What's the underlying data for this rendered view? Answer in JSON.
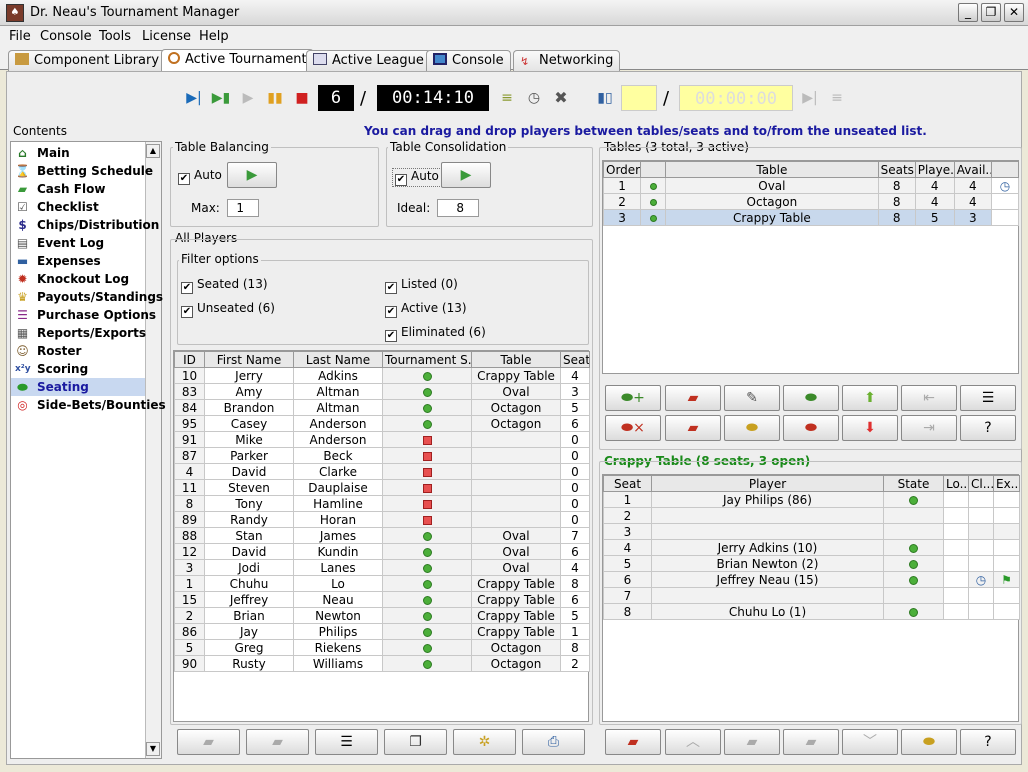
{
  "app": {
    "title": "Dr. Neau's Tournament Manager",
    "window_buttons": [
      "_",
      "❐",
      "✕"
    ]
  },
  "menu": [
    "File",
    "Console",
    "Tools",
    "License",
    "Help"
  ],
  "tabs": [
    {
      "label": "Component Library",
      "icon": "library-icon"
    },
    {
      "label": "Active Tournament",
      "icon": "tournament-icon"
    },
    {
      "label": "Active League",
      "icon": "league-icon"
    },
    {
      "label": "Console",
      "icon": "console-icon"
    },
    {
      "label": "Networking",
      "icon": "networking-icon"
    }
  ],
  "toolbar": {
    "level": "6",
    "separator": "/",
    "clock": "00:14:10",
    "clock2": "00:00:00"
  },
  "hint": "You can drag and drop players between tables/seats and to/from the unseated list.",
  "sidebar": {
    "title": "Contents",
    "items": [
      {
        "label": "Main",
        "icon": "home-icon"
      },
      {
        "label": "Betting Schedule",
        "icon": "schedule-icon"
      },
      {
        "label": "Cash Flow",
        "icon": "cash-icon"
      },
      {
        "label": "Checklist",
        "icon": "checklist-icon"
      },
      {
        "label": "Chips/Distribution",
        "icon": "dollar-icon"
      },
      {
        "label": "Event Log",
        "icon": "log-icon"
      },
      {
        "label": "Expenses",
        "icon": "expenses-icon"
      },
      {
        "label": "Knockout Log",
        "icon": "knockout-icon"
      },
      {
        "label": "Payouts/Standings",
        "icon": "trophy-icon"
      },
      {
        "label": "Purchase Options",
        "icon": "purchase-icon"
      },
      {
        "label": "Reports/Exports",
        "icon": "reports-icon"
      },
      {
        "label": "Roster",
        "icon": "roster-icon"
      },
      {
        "label": "Scoring",
        "icon": "scoring-icon"
      },
      {
        "label": "Seating",
        "icon": "seating-icon"
      },
      {
        "label": "Side-Bets/Bounties",
        "icon": "target-icon"
      }
    ]
  },
  "balancing": {
    "title": "Table Balancing",
    "auto": "Auto",
    "max_label": "Max:",
    "max_value": "1"
  },
  "consolidation": {
    "title": "Table Consolidation",
    "auto": "Auto",
    "ideal_label": "Ideal:",
    "ideal_value": "8"
  },
  "players": {
    "title": "All Players",
    "filter_title": "Filter options",
    "filters": [
      "Seated (13)",
      "Unseated (6)",
      "Listed (0)",
      "Active (13)",
      "Eliminated (6)"
    ],
    "columns": [
      "ID",
      "First Name",
      "Last Name",
      "Tournament S...",
      "Table",
      "Seat"
    ],
    "rows": [
      [
        "10",
        "Jerry",
        "Adkins",
        "active",
        "Crappy Table",
        "4"
      ],
      [
        "83",
        "Amy",
        "Altman",
        "active",
        "Oval",
        "3"
      ],
      [
        "84",
        "Brandon",
        "Altman",
        "active",
        "Octagon",
        "5"
      ],
      [
        "95",
        "Casey",
        "Anderson",
        "active",
        "Octagon",
        "6"
      ],
      [
        "91",
        "Mike",
        "Anderson",
        "eliminated",
        "",
        "0"
      ],
      [
        "87",
        "Parker",
        "Beck",
        "eliminated",
        "",
        "0"
      ],
      [
        "4",
        "David",
        "Clarke",
        "eliminated",
        "",
        "0"
      ],
      [
        "11",
        "Steven",
        "Dauplaise",
        "eliminated",
        "",
        "0"
      ],
      [
        "8",
        "Tony",
        "Hamline",
        "eliminated",
        "",
        "0"
      ],
      [
        "89",
        "Randy",
        "Horan",
        "eliminated",
        "",
        "0"
      ],
      [
        "88",
        "Stan",
        "James",
        "active",
        "Oval",
        "7"
      ],
      [
        "12",
        "David",
        "Kundin",
        "active",
        "Oval",
        "6"
      ],
      [
        "3",
        "Jodi",
        "Lanes",
        "active",
        "Oval",
        "4"
      ],
      [
        "1",
        "Chuhu",
        "Lo",
        "active",
        "Crappy Table",
        "8"
      ],
      [
        "15",
        "Jeffrey",
        "Neau",
        "active",
        "Crappy Table",
        "6"
      ],
      [
        "2",
        "Brian",
        "Newton",
        "active",
        "Crappy Table",
        "5"
      ],
      [
        "86",
        "Jay",
        "Philips",
        "active",
        "Crappy Table",
        "1"
      ],
      [
        "5",
        "Greg",
        "Riekens",
        "active",
        "Octagon",
        "8"
      ],
      [
        "90",
        "Rusty",
        "Williams",
        "active",
        "Octagon",
        "2"
      ]
    ]
  },
  "tables": {
    "title": "Tables (3 total, 3 active)",
    "columns": [
      "Order",
      "",
      "Table",
      "Seats",
      "Playe...",
      "Avail...",
      ""
    ],
    "rows": [
      [
        "1",
        "Oval",
        "8",
        "4",
        "4"
      ],
      [
        "2",
        "Octagon",
        "8",
        "4",
        "4"
      ],
      [
        "3",
        "Crappy Table",
        "8",
        "5",
        "3"
      ]
    ]
  },
  "seating": {
    "title": "Crappy Table (8 seats, 3 open)",
    "columns": [
      "Seat",
      "Player",
      "State",
      "Lo...",
      "Cl...",
      "Ex..."
    ],
    "rows": [
      [
        "1",
        "Jay Philips (86)",
        true
      ],
      [
        "2",
        "",
        false
      ],
      [
        "3",
        "",
        false
      ],
      [
        "4",
        "Jerry Adkins (10)",
        true
      ],
      [
        "5",
        "Brian Newton (2)",
        true
      ],
      [
        "6",
        "Jeffrey Neau (15)",
        true
      ],
      [
        "7",
        "",
        false
      ],
      [
        "8",
        "Chuhu Lo (1)",
        true
      ]
    ]
  },
  "colors": {
    "accent": "#1a1aa0",
    "green_title": "#1a8a1a",
    "active_dot": "#4caf3a",
    "eliminated": "#e85050"
  }
}
